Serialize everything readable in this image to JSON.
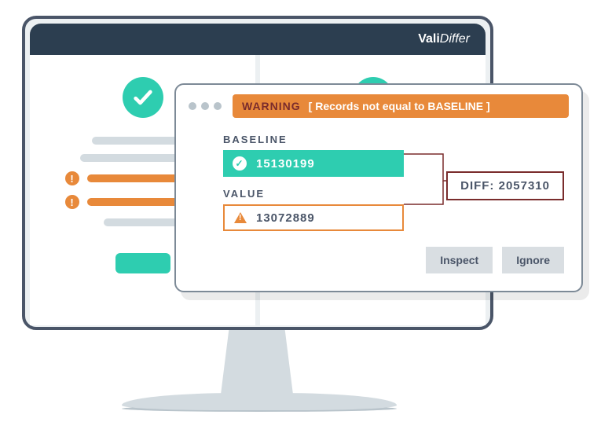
{
  "app": {
    "brand_bold": "Vali",
    "brand_italic": "Differ"
  },
  "warning": {
    "tag": "WARNING",
    "message": "[ Records not equal to BASELINE ]"
  },
  "baseline": {
    "label": "BASELINE",
    "value": "15130199"
  },
  "value": {
    "label": "VALUE",
    "value": "13072889"
  },
  "diff": {
    "label": "DIFF: 2057310"
  },
  "actions": {
    "inspect": "Inspect",
    "ignore": "Ignore"
  }
}
